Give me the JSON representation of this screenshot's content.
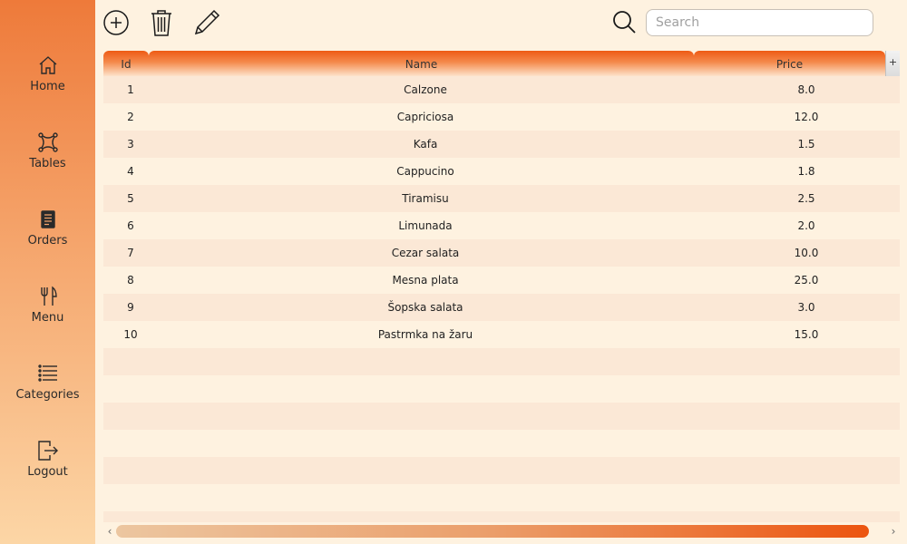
{
  "sidebar": {
    "items": [
      {
        "label": "Home",
        "icon": "home-icon"
      },
      {
        "label": "Tables",
        "icon": "tables-icon"
      },
      {
        "label": "Orders",
        "icon": "orders-icon"
      },
      {
        "label": "Menu",
        "icon": "fork-knife-icon"
      },
      {
        "label": "Categories",
        "icon": "list-icon"
      },
      {
        "label": "Logout",
        "icon": "logout-icon"
      }
    ]
  },
  "toolbar": {
    "add_icon": "plus-circle-icon",
    "delete_icon": "trash-icon",
    "edit_icon": "pencil-icon",
    "search_icon": "search-icon"
  },
  "search": {
    "placeholder": "Search",
    "value": ""
  },
  "table": {
    "columns": [
      "Id",
      "Name",
      "Price"
    ],
    "column_toggle": "+",
    "rows": [
      {
        "id": "1",
        "name": "Calzone",
        "price": "8.0"
      },
      {
        "id": "2",
        "name": "Capriciosa",
        "price": "12.0"
      },
      {
        "id": "3",
        "name": "Kafa",
        "price": "1.5"
      },
      {
        "id": "4",
        "name": "Cappucino",
        "price": "1.8"
      },
      {
        "id": "5",
        "name": "Tiramisu",
        "price": "2.5"
      },
      {
        "id": "6",
        "name": "Limunada",
        "price": "2.0"
      },
      {
        "id": "7",
        "name": "Cezar salata",
        "price": "10.0"
      },
      {
        "id": "8",
        "name": "Mesna plata",
        "price": "25.0"
      },
      {
        "id": "9",
        "name": "Šopska salata",
        "price": "3.0"
      },
      {
        "id": "10",
        "name": "Pastrmka na žaru",
        "price": "15.0"
      }
    ]
  },
  "scrollbar": {
    "left_arrow": "‹",
    "right_arrow": "›"
  },
  "colors": {
    "header_accent": "#ee5a14",
    "sidebar_top": "#ee7a3a",
    "sidebar_bottom": "#fcd6a6",
    "background": "#fef2e0"
  }
}
